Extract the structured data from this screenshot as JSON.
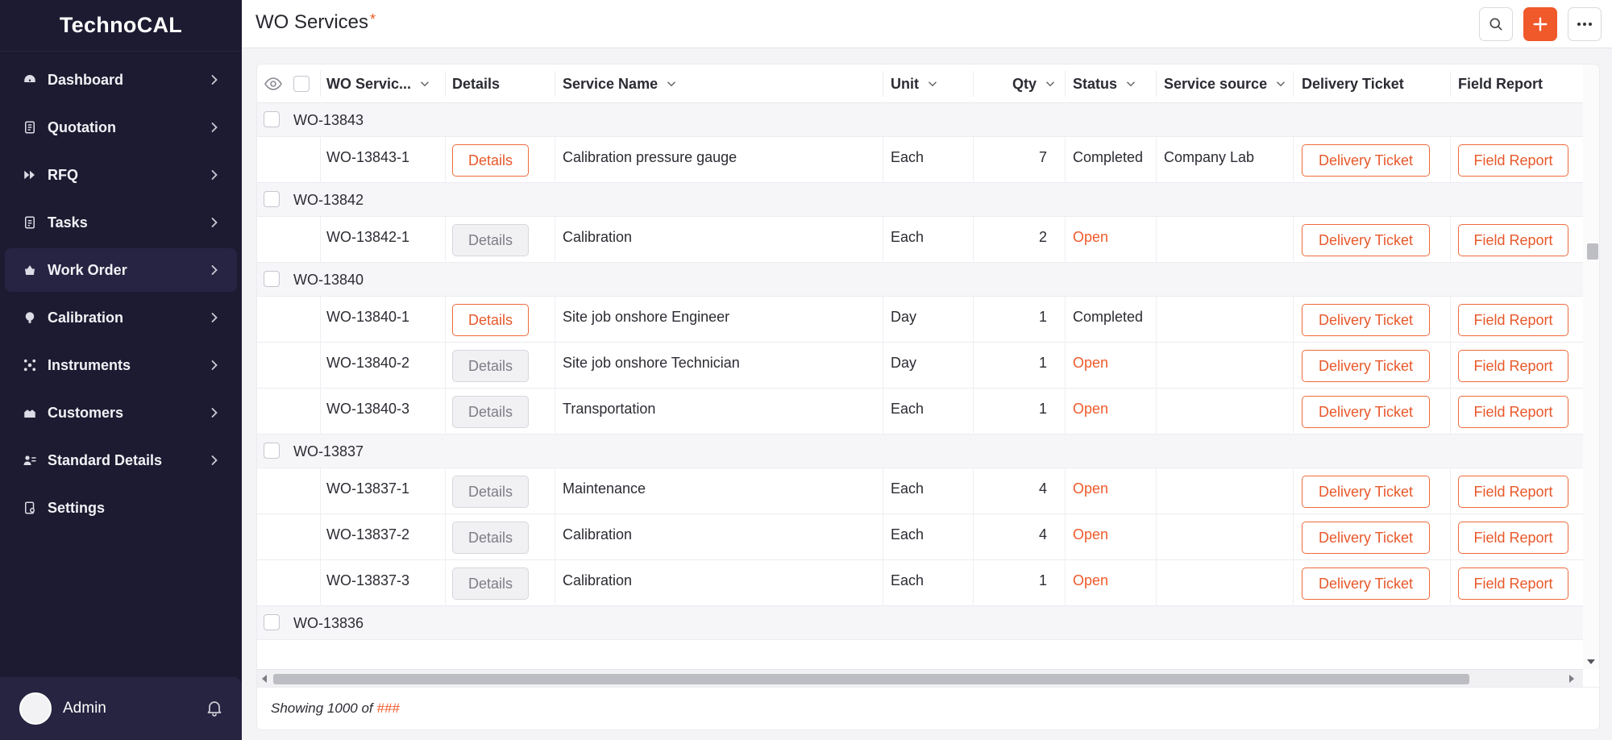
{
  "app": {
    "brand": "TechnoCAL"
  },
  "sidebar": {
    "items": [
      {
        "label": "Dashboard",
        "icon": "dashboard-icon"
      },
      {
        "label": "Quotation",
        "icon": "quotation-icon"
      },
      {
        "label": "RFQ",
        "icon": "rfq-icon"
      },
      {
        "label": "Tasks",
        "icon": "tasks-icon"
      },
      {
        "label": "Work Order",
        "icon": "work-order-icon"
      },
      {
        "label": "Calibration",
        "icon": "calibration-icon"
      },
      {
        "label": "Instruments",
        "icon": "instruments-icon"
      },
      {
        "label": "Customers",
        "icon": "customers-icon"
      },
      {
        "label": "Standard Details",
        "icon": "standard-details-icon"
      },
      {
        "label": "Settings",
        "icon": "settings-icon"
      }
    ],
    "active": "Work Order",
    "user": {
      "name": "Admin"
    }
  },
  "header": {
    "title": "WO Services",
    "required_mark": "*"
  },
  "table": {
    "columns": {
      "wo_service": "WO Servic...",
      "details": "Details",
      "service_name": "Service Name",
      "unit": "Unit",
      "qty": "Qty",
      "status": "Status",
      "service_source": "Service source",
      "delivery_ticket": "Delivery Ticket",
      "field_report": "Field Report"
    },
    "buttons": {
      "details": "Details",
      "delivery_ticket": "Delivery Ticket",
      "field_report": "Field Report"
    },
    "groups": [
      {
        "label": "WO-13843",
        "rows": [
          {
            "id": "WO-13843-1",
            "service_name": "Calibration pressure gauge",
            "unit": "Each",
            "qty": "7",
            "status": "Completed",
            "source": "Company Lab",
            "details_active": true
          }
        ]
      },
      {
        "label": "WO-13842",
        "rows": [
          {
            "id": "WO-13842-1",
            "service_name": "Calibration",
            "unit": "Each",
            "qty": "2",
            "status": "Open",
            "source": "",
            "details_active": false
          }
        ]
      },
      {
        "label": "WO-13840",
        "rows": [
          {
            "id": "WO-13840-1",
            "service_name": "Site job onshore Engineer",
            "unit": "Day",
            "qty": "1",
            "status": "Completed",
            "source": "",
            "details_active": true
          },
          {
            "id": "WO-13840-2",
            "service_name": "Site job onshore Technician",
            "unit": "Day",
            "qty": "1",
            "status": "Open",
            "source": "",
            "details_active": false
          },
          {
            "id": "WO-13840-3",
            "service_name": "Transportation",
            "unit": "Each",
            "qty": "1",
            "status": "Open",
            "source": "",
            "details_active": false
          }
        ]
      },
      {
        "label": "WO-13837",
        "rows": [
          {
            "id": "WO-13837-1",
            "service_name": "Maintenance",
            "unit": "Each",
            "qty": "4",
            "status": "Open",
            "source": "",
            "details_active": false
          },
          {
            "id": "WO-13837-2",
            "service_name": "Calibration",
            "unit": "Each",
            "qty": "4",
            "status": "Open",
            "source": "",
            "details_active": false
          },
          {
            "id": "WO-13837-3",
            "service_name": "Calibration",
            "unit": "Each",
            "qty": "1",
            "status": "Open",
            "source": "",
            "details_active": false
          }
        ]
      },
      {
        "label": "WO-13836",
        "rows": []
      }
    ]
  },
  "footer": {
    "showing": "Showing 1000 of ",
    "total": "###"
  },
  "colors": {
    "accent": "#f0592a",
    "sidebar_bg": "#1d1b31",
    "open_status": "#ef5a2a"
  }
}
